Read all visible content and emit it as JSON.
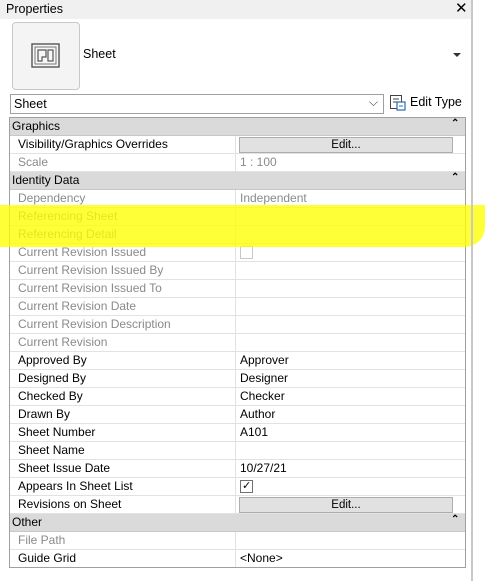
{
  "window": {
    "title": "Properties",
    "close_glyph": "✕"
  },
  "type_selector": {
    "name": "Sheet",
    "icon": "sheet-icon"
  },
  "instance_filter": {
    "value": "Sheet",
    "chevron": "⌵"
  },
  "edit_type": {
    "label": "Edit Type",
    "icon": "edit-type-icon"
  },
  "groups": [
    {
      "title": "Graphics",
      "collapse_glyph": "⌃",
      "rows": [
        {
          "name": "Visibility/Graphics Overrides",
          "kind": "button",
          "value": "Edit...",
          "read_only": false
        },
        {
          "name": "Scale",
          "kind": "text",
          "value": "1 : 100",
          "read_only": true
        }
      ]
    },
    {
      "title": "Identity Data",
      "collapse_glyph": "⌃",
      "rows": [
        {
          "name": "Dependency",
          "kind": "text",
          "value": "Independent",
          "read_only": true
        },
        {
          "name": "Referencing Sheet",
          "kind": "text",
          "value": "",
          "read_only": true
        },
        {
          "name": "Referencing Detail",
          "kind": "text",
          "value": "",
          "read_only": true
        },
        {
          "name": "Current Revision Issued",
          "kind": "checkbox",
          "value": false,
          "read_only": true
        },
        {
          "name": "Current Revision Issued By",
          "kind": "text",
          "value": "",
          "read_only": true
        },
        {
          "name": "Current Revision Issued To",
          "kind": "text",
          "value": "",
          "read_only": true
        },
        {
          "name": "Current Revision Date",
          "kind": "text",
          "value": "",
          "read_only": true
        },
        {
          "name": "Current Revision Description",
          "kind": "text",
          "value": "",
          "read_only": true
        },
        {
          "name": "Current Revision",
          "kind": "text",
          "value": "",
          "read_only": true
        },
        {
          "name": "Approved By",
          "kind": "text",
          "value": "Approver",
          "read_only": false
        },
        {
          "name": "Designed By",
          "kind": "text",
          "value": "Designer",
          "read_only": false
        },
        {
          "name": "Checked By",
          "kind": "text",
          "value": "Checker",
          "read_only": false
        },
        {
          "name": "Drawn By",
          "kind": "text",
          "value": "Author",
          "read_only": false
        },
        {
          "name": "Sheet Number",
          "kind": "text",
          "value": "A101",
          "read_only": false
        },
        {
          "name": "Sheet Name",
          "kind": "text",
          "value": "",
          "read_only": false
        },
        {
          "name": "Sheet Issue Date",
          "kind": "text",
          "value": "10/27/21",
          "read_only": false
        },
        {
          "name": "Appears In Sheet List",
          "kind": "checkbox",
          "value": true,
          "read_only": false
        },
        {
          "name": "Revisions on Sheet",
          "kind": "button",
          "value": "Edit...",
          "read_only": false
        }
      ]
    },
    {
      "title": "Other",
      "collapse_glyph": "⌃",
      "rows": [
        {
          "name": "File Path",
          "kind": "text",
          "value": "",
          "read_only": true
        },
        {
          "name": "Guide Grid",
          "kind": "text",
          "value": "<None>",
          "read_only": false
        }
      ]
    }
  ],
  "annotation": {
    "highlight_color": "#ffff00"
  }
}
